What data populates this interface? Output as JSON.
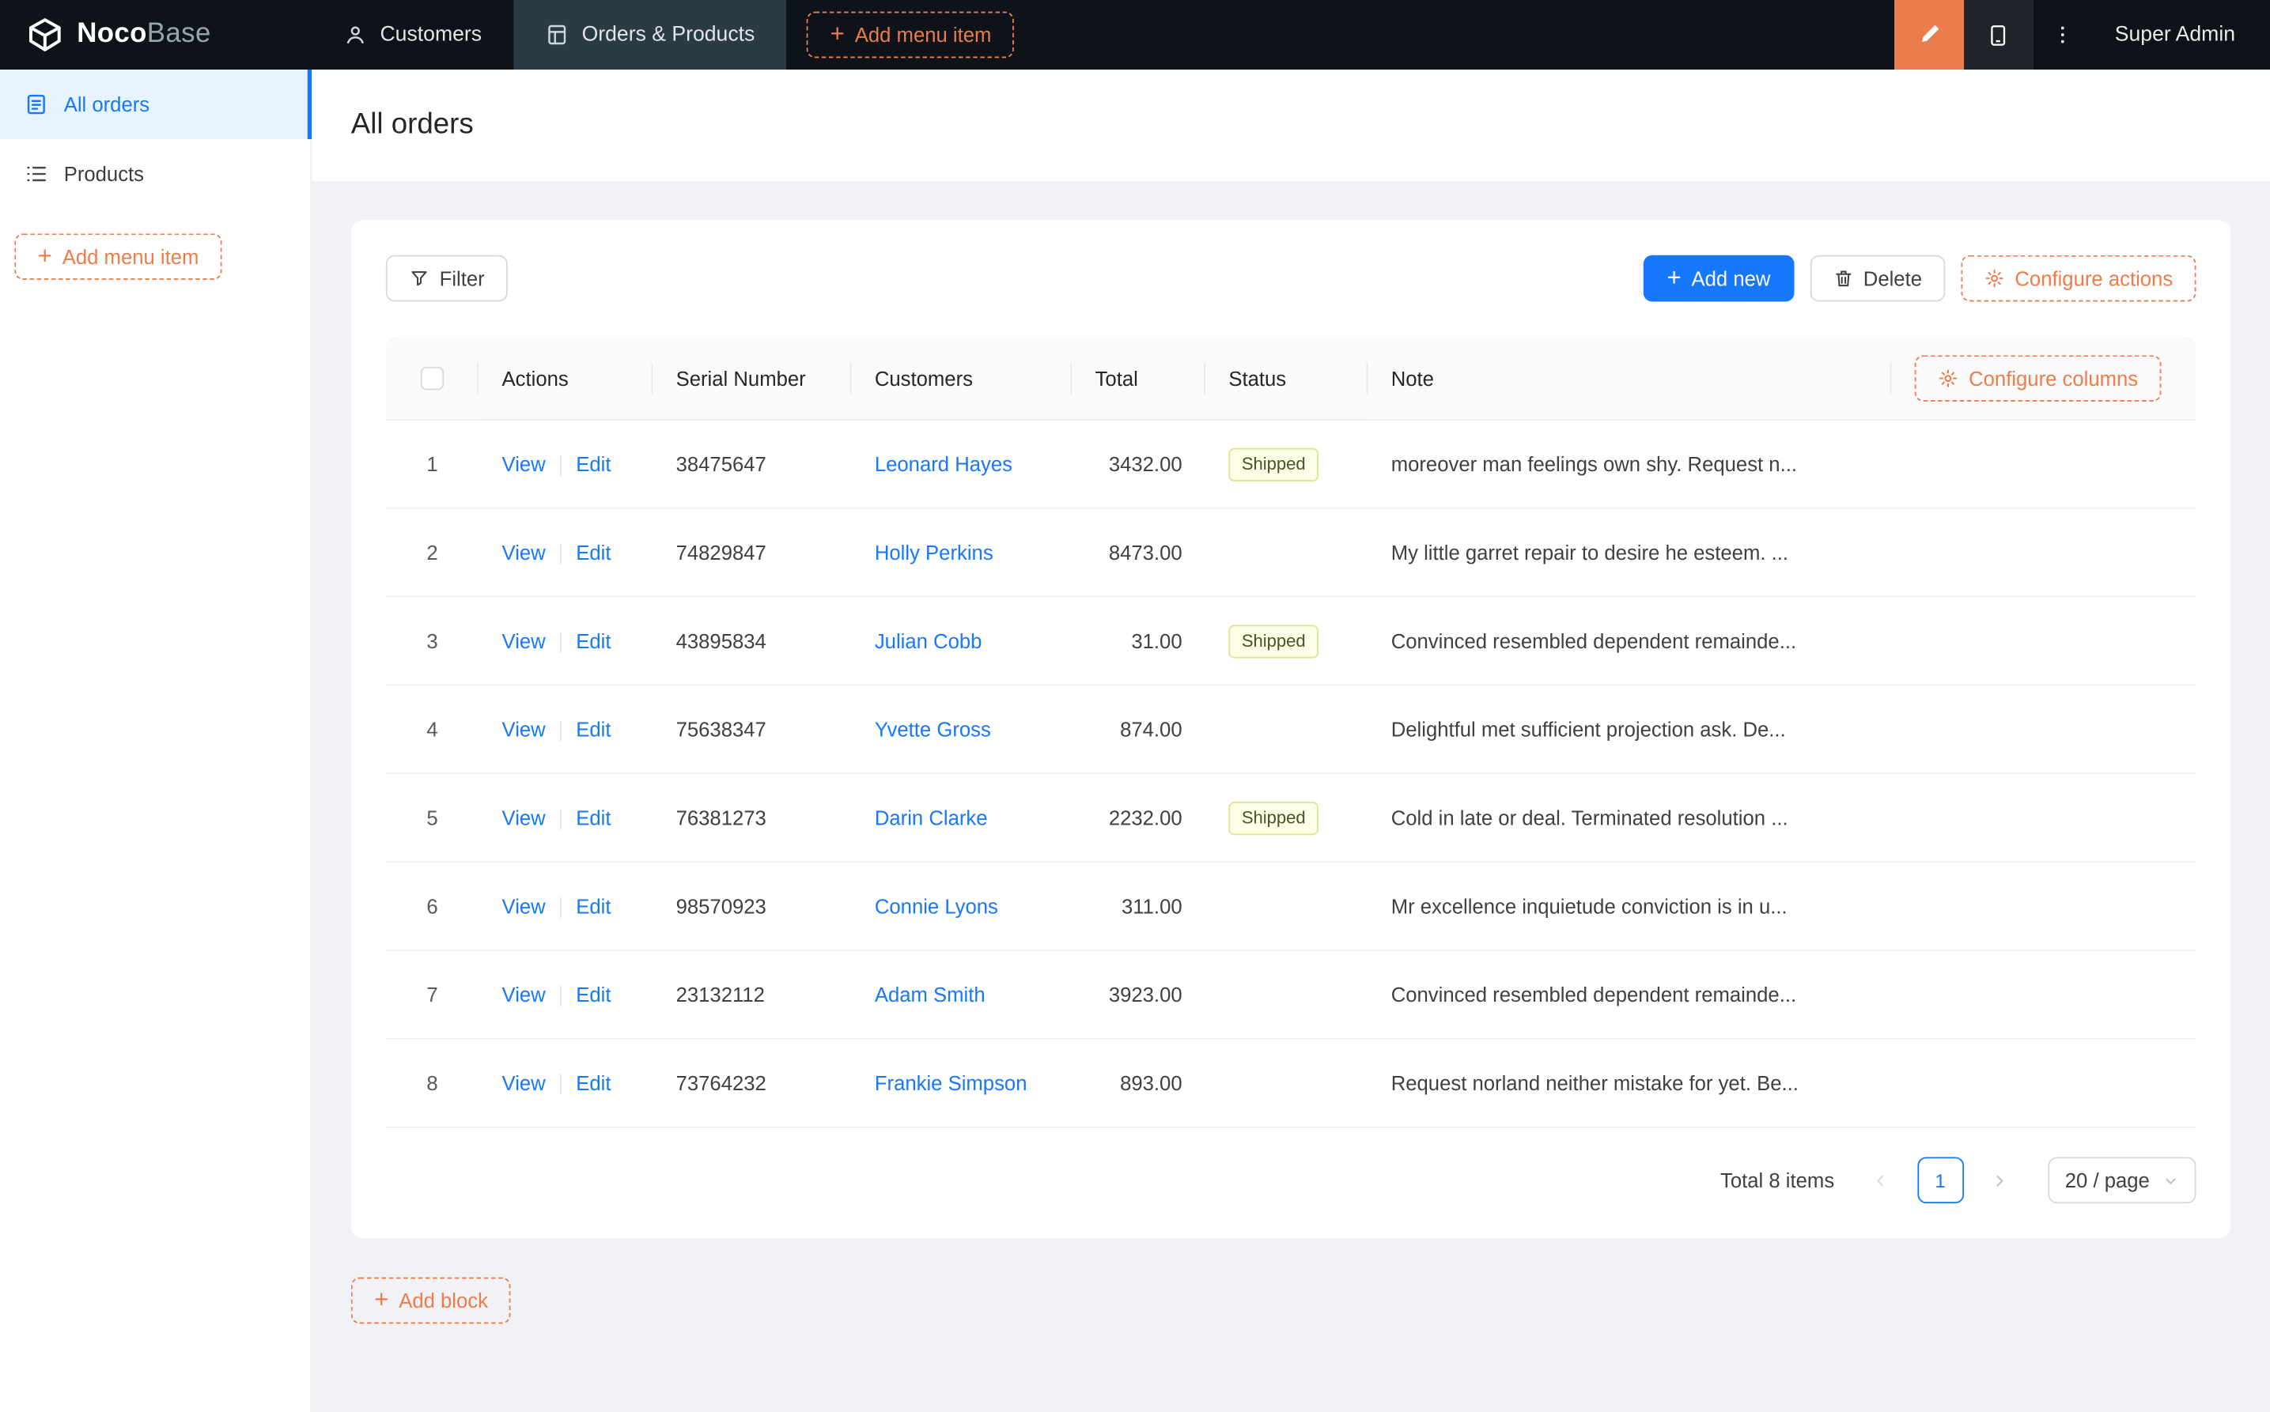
{
  "colors": {
    "accent_orange": "#ed7c4a",
    "primary_blue": "#1677ff",
    "navbar_bg": "#0d1318",
    "sidebar_active_bg": "#e7f4fe",
    "status_shipped_bg": "#fcffe6",
    "status_shipped_border": "#dee58b"
  },
  "icons": {
    "logo": "cube",
    "customers": "person-outline",
    "orders_products": "table-file",
    "all_orders": "file-text",
    "products": "unordered-list",
    "add": "plus",
    "ui_editor": "highlighter-pen",
    "mobile_preview": "tablet",
    "more": "kebab-vertical-dots",
    "filter": "funnel",
    "delete": "trash",
    "configure": "gear",
    "prev": "chevron-left",
    "next": "chevron-right",
    "select": "chevron-down"
  },
  "topnav": {
    "logo_primary": "Noco",
    "logo_secondary": "Base",
    "items": [
      {
        "label": "Customers"
      },
      {
        "label": "Orders & Products"
      }
    ],
    "add_menu_item": "Add menu item",
    "user": "Super Admin"
  },
  "sidebar": {
    "items": [
      {
        "label": "All orders"
      },
      {
        "label": "Products"
      }
    ],
    "add_menu_item": "Add menu item"
  },
  "page": {
    "title": "All orders",
    "toolbar": {
      "filter": "Filter",
      "add_new": "Add new",
      "delete": "Delete",
      "configure_actions": "Configure actions"
    },
    "table": {
      "headers": [
        "Actions",
        "Serial Number",
        "Customers",
        "Total",
        "Status",
        "Note"
      ],
      "configure_columns": "Configure columns",
      "view_label": "View",
      "edit_label": "Edit",
      "rows": [
        {
          "index": "1",
          "serial": "38475647",
          "customer": "Leonard Hayes",
          "total": "3432.00",
          "status": "Shipped",
          "note": "moreover man feelings own shy. Request n..."
        },
        {
          "index": "2",
          "serial": "74829847",
          "customer": "Holly Perkins",
          "total": "8473.00",
          "status": "",
          "note": "My little garret repair to desire he esteem. ..."
        },
        {
          "index": "3",
          "serial": "43895834",
          "customer": "Julian Cobb",
          "total": "31.00",
          "status": "Shipped",
          "note": "Convinced resembled dependent remainde..."
        },
        {
          "index": "4",
          "serial": "75638347",
          "customer": "Yvette Gross",
          "total": "874.00",
          "status": "",
          "note": "Delightful met sufficient projection ask. De..."
        },
        {
          "index": "5",
          "serial": "76381273",
          "customer": "Darin Clarke",
          "total": "2232.00",
          "status": "Shipped",
          "note": "Cold in late or deal. Terminated resolution ..."
        },
        {
          "index": "6",
          "serial": "98570923",
          "customer": "Connie Lyons",
          "total": "311.00",
          "status": "",
          "note": "Mr excellence inquietude conviction is in u..."
        },
        {
          "index": "7",
          "serial": "23132112",
          "customer": "Adam Smith",
          "total": "3923.00",
          "status": "",
          "note": "Convinced resembled dependent remainde..."
        },
        {
          "index": "8",
          "serial": "73764232",
          "customer": "Frankie Simpson",
          "total": "893.00",
          "status": "",
          "note": "Request norland neither mistake for yet. Be..."
        }
      ]
    },
    "pagination": {
      "total_label": "Total 8 items",
      "current": "1",
      "page_size": "20 / page"
    },
    "add_block": "Add block"
  }
}
